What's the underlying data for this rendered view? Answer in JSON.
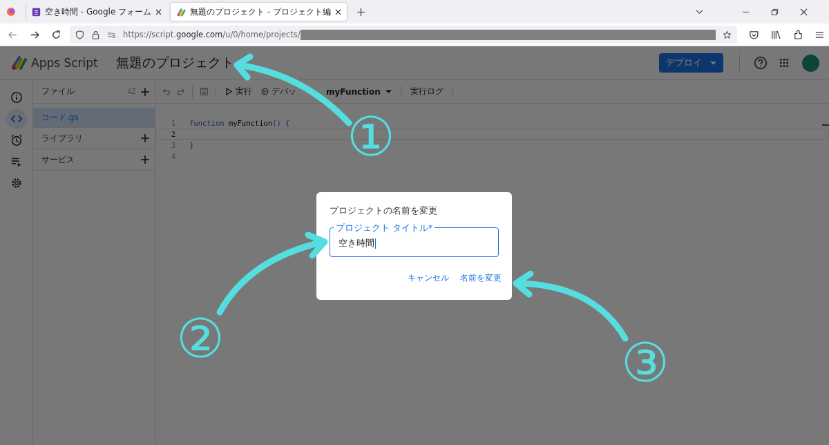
{
  "browser": {
    "tabs": [
      {
        "title": "空き時間 - Google フォーム",
        "selected": false,
        "kind": "form"
      },
      {
        "title": "無題のプロジェクト - プロジェクト編",
        "selected": true,
        "kind": "script"
      }
    ],
    "url": "https://script.**google.com**/u/0/home/projects/"
  },
  "header": {
    "logo_text": "Apps Script",
    "project_title": "無題のプロジェクト",
    "deploy_button": "デプロイ"
  },
  "rail": [
    {
      "kind": "info",
      "selected": false
    },
    {
      "kind": "code",
      "selected": true
    },
    {
      "kind": "clock",
      "selected": false
    },
    {
      "kind": "executions",
      "selected": false
    },
    {
      "kind": "settings",
      "selected": false
    }
  ],
  "files_panel": {
    "heading": "ファイル",
    "sort_label": "AZ",
    "files": [
      {
        "name": "コード.gs",
        "selected": true
      }
    ],
    "sections": [
      {
        "label": "ライブラリ"
      },
      {
        "label": "サービス"
      }
    ]
  },
  "toolbar": {
    "run": "実行",
    "debug": "デバッ",
    "function": "myFunction",
    "log": "実行ログ"
  },
  "editor": {
    "lines": [
      {
        "number": "1",
        "current": false,
        "tokens": [
          {
            "text": "function",
            "kind": "keyword"
          },
          {
            "text": " myFunction",
            "kind": "name"
          },
          {
            "text": "() {",
            "kind": "punct"
          }
        ]
      },
      {
        "number": "2",
        "current": true
      },
      {
        "number": "3",
        "current": false,
        "tokens": [
          {
            "text": "}",
            "kind": "punct"
          }
        ]
      },
      {
        "number": "4",
        "current": false
      }
    ]
  },
  "dialog": {
    "title": "プロジェクトの名前を変更",
    "field_label": "プロジェクト タイトル*",
    "field_value": "空き時間",
    "buttons": [
      "キャンセル",
      "名前を変更"
    ]
  },
  "annotations": [
    {
      "label": "①"
    },
    {
      "label": "②"
    },
    {
      "label": "③"
    }
  ]
}
